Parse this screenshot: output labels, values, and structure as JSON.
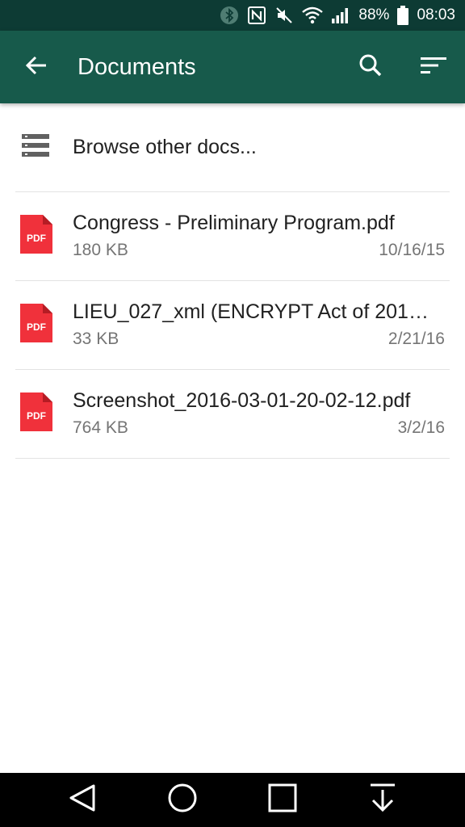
{
  "status_bar": {
    "battery": "88%",
    "time": "08:03",
    "icons": [
      "bluetooth-icon",
      "nfc-icon",
      "mute-icon",
      "wifi-icon",
      "signal-icon",
      "battery-icon"
    ]
  },
  "app_bar": {
    "title": "Documents",
    "back_icon": "arrow-left-icon",
    "search_icon": "search-icon",
    "sort_icon": "sort-icon",
    "color": "#175a4b"
  },
  "browse": {
    "label": "Browse other docs...",
    "icon": "list-icon"
  },
  "documents": [
    {
      "name": "Congress - Preliminary Program.pdf",
      "size": "180 KB",
      "date": "10/16/15",
      "icon_label": "PDF"
    },
    {
      "name": "LIEU_027_xml (ENCRYPT Act of 201…",
      "size": "33 KB",
      "date": "2/21/16",
      "icon_label": "PDF"
    },
    {
      "name": "Screenshot_2016-03-01-20-02-12.pdf",
      "size": "764 KB",
      "date": "3/2/16",
      "icon_label": "PDF"
    }
  ],
  "nav_bar": {
    "icons": [
      "back-triangle-icon",
      "home-circle-icon",
      "recents-square-icon",
      "download-icon"
    ]
  }
}
